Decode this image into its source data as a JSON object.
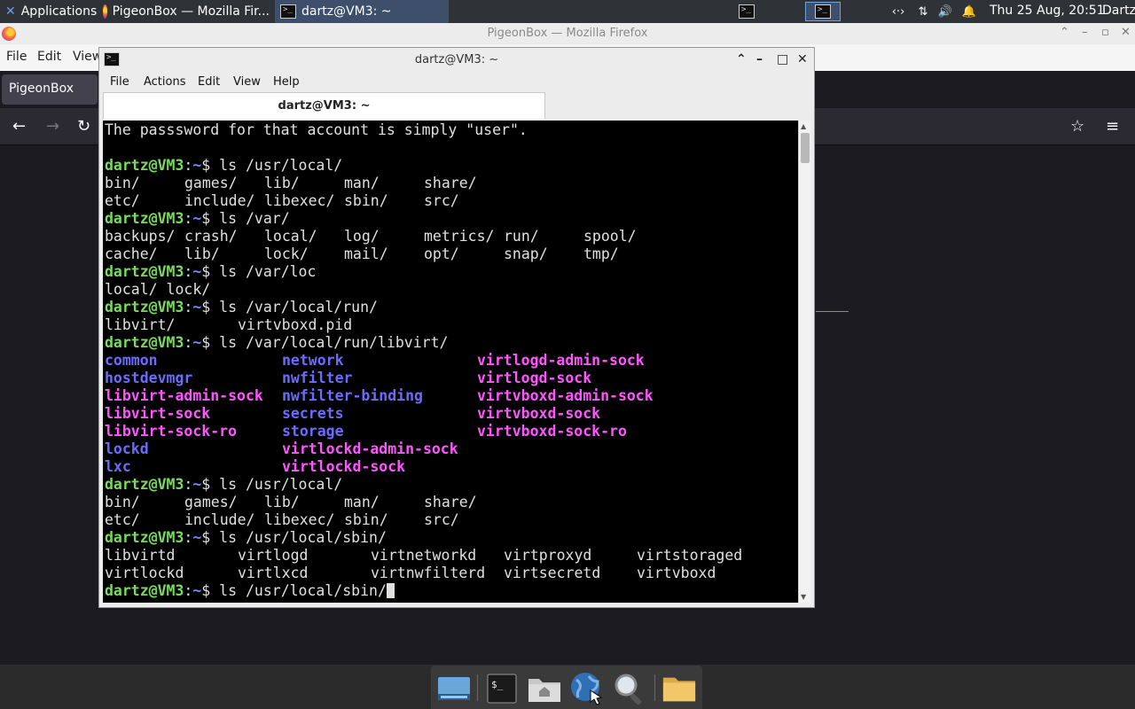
{
  "top_panel": {
    "apps_label": "Applications",
    "task_firefox": "PigeonBox — Mozilla Fir...",
    "task_terminal": "dartz@VM3: ~",
    "clock": "Thu 25 Aug, 20:51",
    "user": "Dartz",
    "tray_icons": [
      "network-arrows-icon",
      "transfer-icon",
      "volume-icon",
      "notification-bell-icon"
    ]
  },
  "firefox": {
    "title": "PigeonBox — Mozilla Firefox",
    "menu": [
      "File",
      "Edit",
      "View"
    ],
    "tab_label": "PigeonBox"
  },
  "terminal": {
    "title": "dartz@VM3: ~",
    "menu": [
      "File",
      "Actions",
      "Edit",
      "View",
      "Help"
    ],
    "tab_label": "dartz@VM3: ~",
    "prompt": {
      "user": "dartz@VM3",
      "sep": ":",
      "path": "~",
      "symbol": "$ "
    },
    "colors": {
      "prompt": "#78dc5a",
      "dir": "#6b6bff",
      "socket": "#ff55ff",
      "text": "#e0e0e0"
    },
    "lines": [
      {
        "type": "text",
        "text": "The passsword for that account is simply \"user\"."
      },
      {
        "type": "text",
        "text": ""
      },
      {
        "type": "prompt",
        "cmd": "ls /usr/local/"
      },
      {
        "type": "ls",
        "cells": [
          [
            "bin/",
            "plain"
          ],
          [
            "games/",
            "plain"
          ],
          [
            "lib/",
            "plain"
          ],
          [
            "man/",
            "plain"
          ],
          [
            "share/",
            "plain"
          ]
        ]
      },
      {
        "type": "ls",
        "cells": [
          [
            "etc/",
            "plain"
          ],
          [
            "include/",
            "plain"
          ],
          [
            "libexec/",
            "plain"
          ],
          [
            "sbin/",
            "plain"
          ],
          [
            "src/",
            "plain"
          ]
        ]
      },
      {
        "type": "prompt",
        "cmd": "ls /var/"
      },
      {
        "type": "ls",
        "cells": [
          [
            "backups/",
            "plain"
          ],
          [
            "crash/",
            "plain"
          ],
          [
            "local/",
            "plain"
          ],
          [
            "log/",
            "plain"
          ],
          [
            "metrics/",
            "plain"
          ],
          [
            "run/",
            "plain"
          ],
          [
            "spool/",
            "plain"
          ]
        ]
      },
      {
        "type": "ls",
        "cells": [
          [
            "cache/",
            "plain"
          ],
          [
            "lib/",
            "plain"
          ],
          [
            "lock/",
            "plain"
          ],
          [
            "mail/",
            "plain"
          ],
          [
            "opt/",
            "plain"
          ],
          [
            "snap/",
            "plain"
          ],
          [
            "tmp/",
            "plain"
          ]
        ]
      },
      {
        "type": "prompt",
        "cmd": "ls /var/loc"
      },
      {
        "type": "text",
        "text": "local/ lock/"
      },
      {
        "type": "prompt",
        "cmd": "ls /var/local/run/"
      },
      {
        "type": "ls",
        "cells": [
          [
            "libvirt/",
            "plain"
          ],
          [
            "virtvboxd.pid",
            "plain"
          ]
        ]
      },
      {
        "type": "prompt",
        "cmd": "ls /var/local/run/libvirt/"
      },
      {
        "type": "ls",
        "cells": [
          [
            "common",
            "dir"
          ],
          [
            "network",
            "dir"
          ],
          [
            "virtlogd-admin-sock",
            "sock"
          ]
        ]
      },
      {
        "type": "ls",
        "cells": [
          [
            "hostdevmgr",
            "dir"
          ],
          [
            "nwfilter",
            "dir"
          ],
          [
            "virtlogd-sock",
            "sock"
          ]
        ]
      },
      {
        "type": "ls",
        "cells": [
          [
            "libvirt-admin-sock",
            "sock"
          ],
          [
            "nwfilter-binding",
            "dir"
          ],
          [
            "virtvboxd-admin-sock",
            "sock"
          ]
        ]
      },
      {
        "type": "ls",
        "cells": [
          [
            "libvirt-sock",
            "sock"
          ],
          [
            "secrets",
            "dir"
          ],
          [
            "virtvboxd-sock",
            "sock"
          ]
        ]
      },
      {
        "type": "ls",
        "cells": [
          [
            "libvirt-sock-ro",
            "sock"
          ],
          [
            "storage",
            "dir"
          ],
          [
            "virtvboxd-sock-ro",
            "sock"
          ]
        ]
      },
      {
        "type": "ls",
        "cells": [
          [
            "lockd",
            "dir"
          ],
          [
            "virtlockd-admin-sock",
            "sock"
          ]
        ]
      },
      {
        "type": "ls",
        "cells": [
          [
            "lxc",
            "dir"
          ],
          [
            "virtlockd-sock",
            "sock"
          ]
        ]
      },
      {
        "type": "prompt",
        "cmd": "ls /usr/local/"
      },
      {
        "type": "ls",
        "cells": [
          [
            "bin/",
            "plain"
          ],
          [
            "games/",
            "plain"
          ],
          [
            "lib/",
            "plain"
          ],
          [
            "man/",
            "plain"
          ],
          [
            "share/",
            "plain"
          ]
        ]
      },
      {
        "type": "ls",
        "cells": [
          [
            "etc/",
            "plain"
          ],
          [
            "include/",
            "plain"
          ],
          [
            "libexec/",
            "plain"
          ],
          [
            "sbin/",
            "plain"
          ],
          [
            "src/",
            "plain"
          ]
        ]
      },
      {
        "type": "prompt",
        "cmd": "ls /usr/local/sbin/"
      },
      {
        "type": "ls",
        "cells": [
          [
            "libvirtd",
            "plain"
          ],
          [
            "virtlogd",
            "plain"
          ],
          [
            "virtnetworkd",
            "plain"
          ],
          [
            "virtproxyd",
            "plain"
          ],
          [
            "virtstoraged",
            "plain"
          ]
        ]
      },
      {
        "type": "ls",
        "cells": [
          [
            "virtlockd",
            "plain"
          ],
          [
            "virtlxcd",
            "plain"
          ],
          [
            "virtnwfilterd",
            "plain"
          ],
          [
            "virtsecretd",
            "plain"
          ],
          [
            "virtvboxd",
            "plain"
          ]
        ]
      },
      {
        "type": "prompt",
        "cmd": "ls /usr/local/sbin/",
        "cursor": true
      }
    ]
  },
  "dock": {
    "items": [
      "show-desktop-icon",
      "terminal-icon",
      "home-folder-icon",
      "web-browser-icon",
      "search-icon",
      "files-folder-icon"
    ]
  }
}
